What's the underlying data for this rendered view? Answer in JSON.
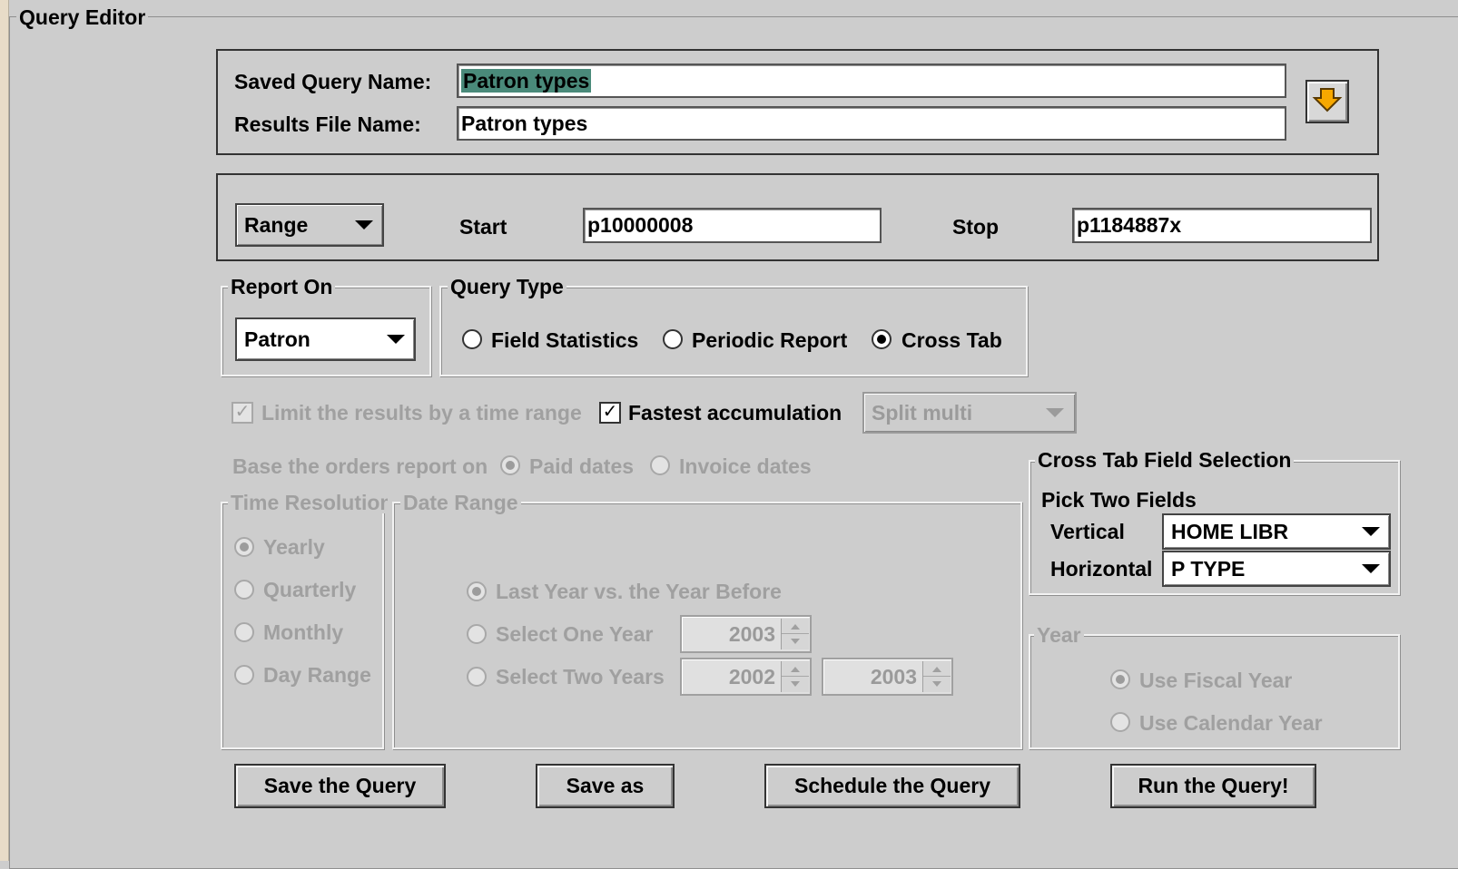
{
  "window": {
    "title": "Query Editor"
  },
  "names": {
    "saved_label": "Saved Query Name:",
    "saved_value": "Patron types",
    "results_label": "Results File Name:",
    "results_value": "Patron types",
    "download_icon": "arrow-down-icon"
  },
  "range": {
    "type": "Range",
    "start_label": "Start",
    "start_value": "p10000008",
    "stop_label": "Stop",
    "stop_value": "p1184887x"
  },
  "report_on": {
    "legend": "Report On",
    "value": "Patron"
  },
  "query_type": {
    "legend": "Query Type",
    "options": [
      "Field Statistics",
      "Periodic Report",
      "Cross Tab"
    ],
    "selected": "Cross Tab"
  },
  "options": {
    "limit_label": "Limit the results by a time range",
    "fastest_label": "Fastest accumulation",
    "split_value": "Split multi",
    "orders_label": "Base the orders report on",
    "paid_label": "Paid dates",
    "invoice_label": "Invoice dates"
  },
  "time_resolution": {
    "legend": "Time Resolution",
    "options": [
      "Yearly",
      "Quarterly",
      "Monthly",
      "Day Range"
    ],
    "selected": "Yearly"
  },
  "date_range": {
    "legend": "Date Range",
    "last_year": "Last Year vs. the Year Before",
    "one_year": "Select One Year",
    "one_year_value": "2003",
    "two_years": "Select Two Years",
    "two_year_from": "2002",
    "two_year_to": "2003"
  },
  "cross_tab": {
    "legend": "Cross Tab Field Selection",
    "heading": "Pick Two Fields",
    "vertical_label": "Vertical",
    "vertical_value": "HOME LIBR",
    "horizontal_label": "Horizontal",
    "horizontal_value": "P TYPE"
  },
  "year": {
    "legend": "Year",
    "fiscal": "Use Fiscal Year",
    "calendar": "Use Calendar Year"
  },
  "buttons": {
    "save": "Save the Query",
    "save_as": "Save as",
    "schedule": "Schedule the Query",
    "run": "Run the Query!"
  },
  "colors": {
    "background": "#cdcdcd",
    "selection": "#4a8a7a",
    "disabled_text": "#a0a0a0"
  }
}
